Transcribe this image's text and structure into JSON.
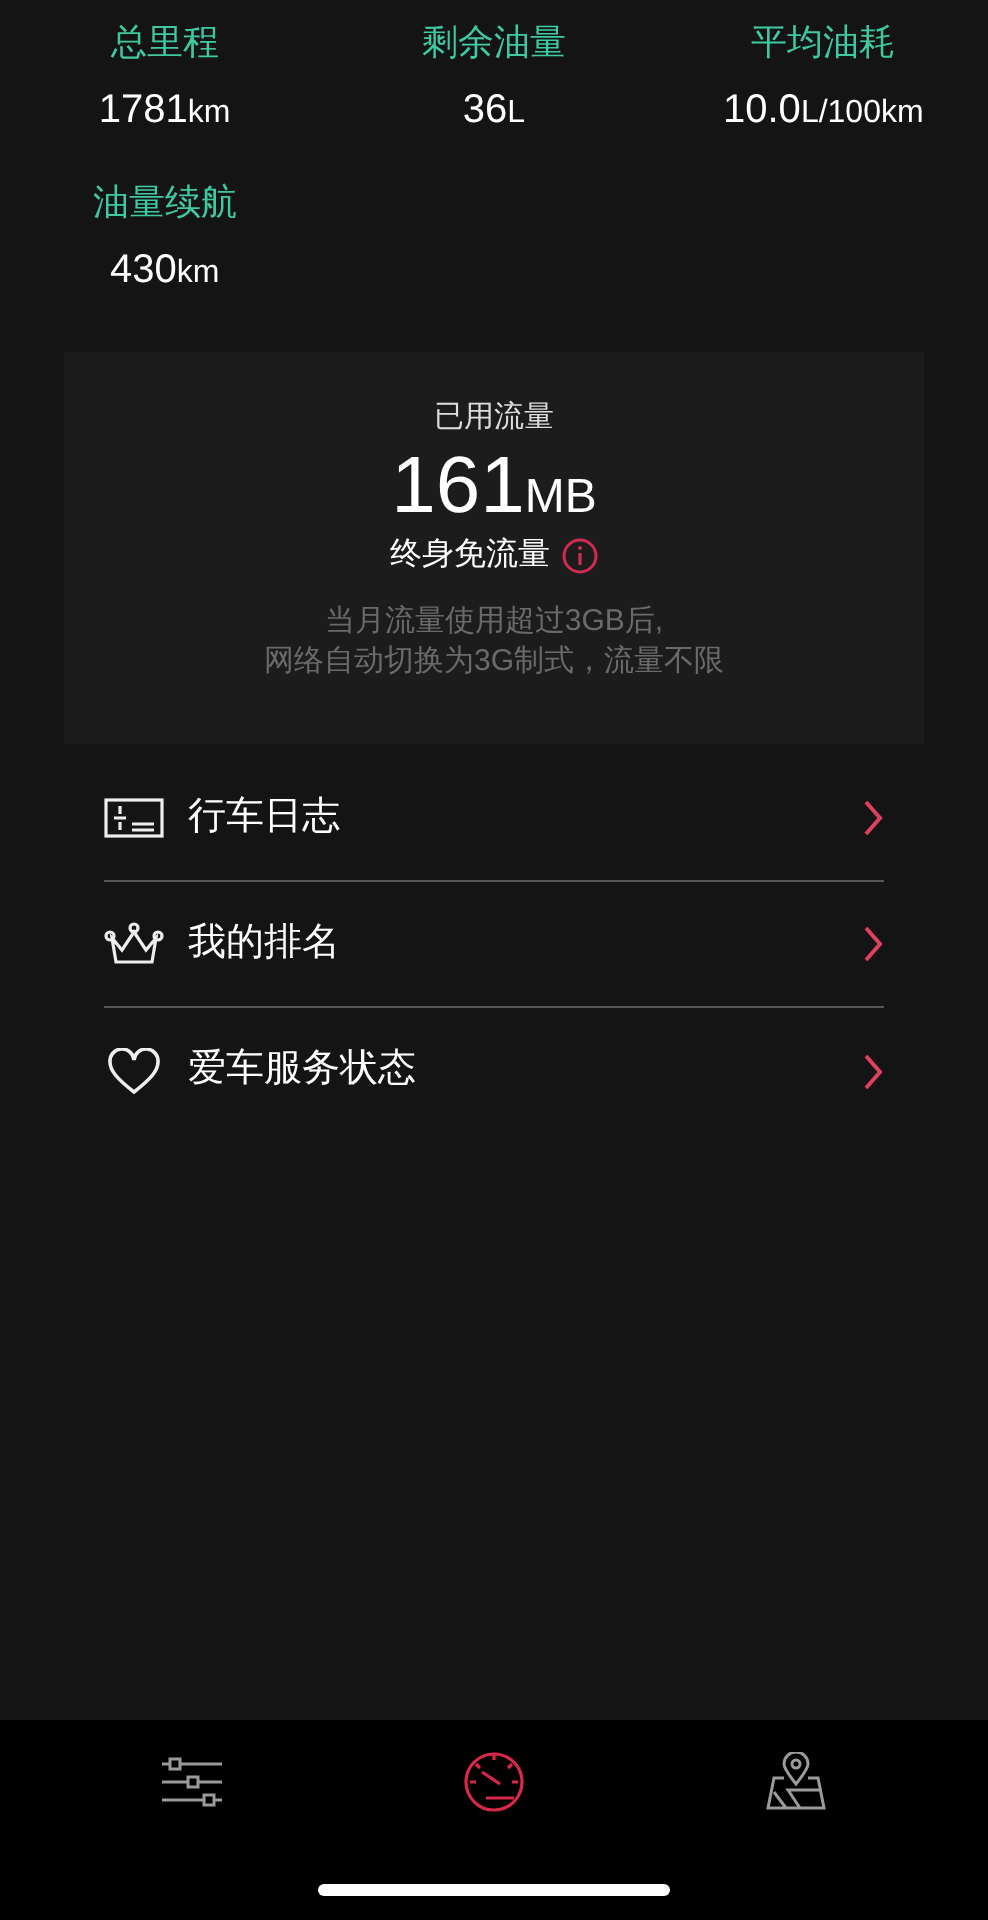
{
  "stats": [
    {
      "label": "总里程",
      "value": "1781",
      "unit": "km"
    },
    {
      "label": "剩余油量",
      "value": "36",
      "unit": "L"
    },
    {
      "label": "平均油耗",
      "value": "10.0",
      "unit": "L/100km"
    },
    {
      "label": "油量续航",
      "value": "430",
      "unit": "km"
    }
  ],
  "data_card": {
    "title": "已用流量",
    "value": "161",
    "unit": "MB",
    "plan": "终身免流量",
    "note_lines": [
      "当月流量使用超过3GB后,",
      "网络自动切换为3G制式，流量不限"
    ]
  },
  "menu": [
    {
      "kind": "log",
      "label": "行车日志"
    },
    {
      "kind": "crown",
      "label": "我的排名"
    },
    {
      "kind": "heart",
      "label": "爱车服务状态"
    }
  ],
  "tab_bar": [
    {
      "kind": "settings",
      "selected": false
    },
    {
      "kind": "speedometer",
      "selected": true
    },
    {
      "kind": "map",
      "selected": false
    }
  ]
}
